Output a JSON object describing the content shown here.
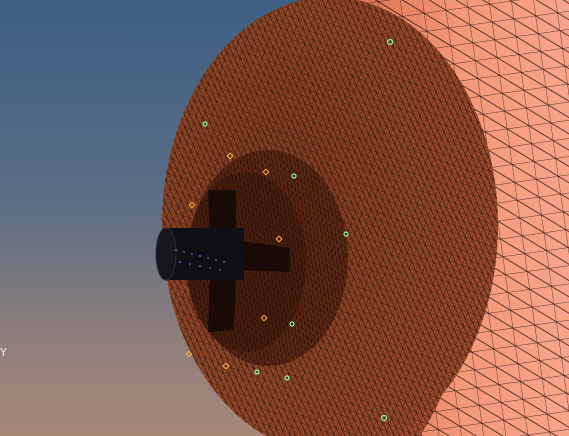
{
  "viewport": {
    "axis_label": "Y",
    "colors": {
      "background_top": "#3d5f86",
      "background_bottom": "#a88777",
      "shell_face": "#8a3f22",
      "shell_body": "#f08f6a",
      "hub": "#6b2d17",
      "mesh_lines": "#1a0d08",
      "shaft": "#101018",
      "node_markers": "#7dff9a",
      "hub_markers": "#ffb02e"
    },
    "icons": [
      "triad-y-axis-icon"
    ]
  }
}
